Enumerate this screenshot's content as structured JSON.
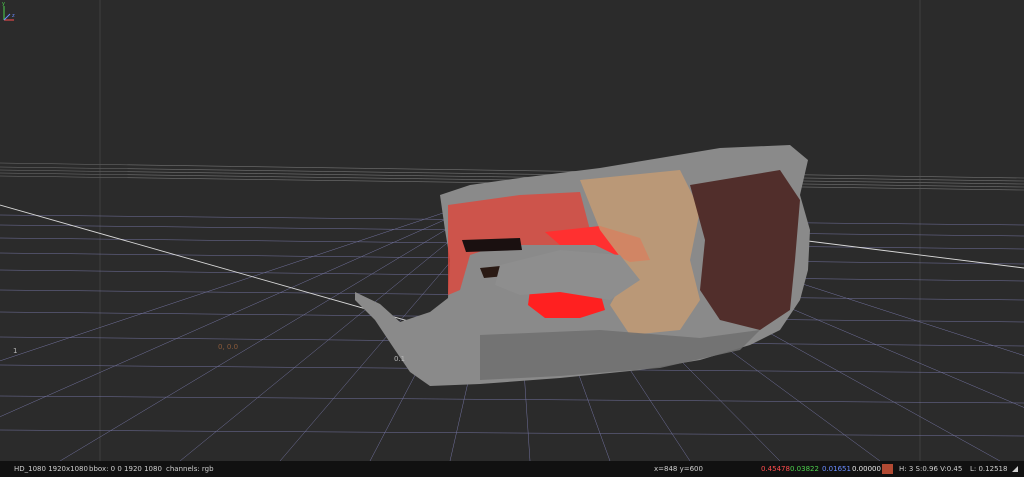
{
  "viewport": {
    "label_origin": "1",
    "label_near_object": "0.1",
    "label_left_marker": "0, 0.0"
  },
  "statusbar": {
    "format": "HD_1080 1920x1080",
    "bbox": "bbox: 0 0 1920 1080",
    "channels": "channels: rgb",
    "coords": "x=848 y=600",
    "r": "0.45478",
    "g": "0.03822",
    "b": "0.01651",
    "a": "0.00000",
    "swatch_color": "#b24a33",
    "hsv": "H:  3 S:0.96 V:0.45",
    "lum": "L: 0.12518"
  },
  "colors": {
    "r": "#ff4d4d",
    "g": "#4dd04d",
    "b": "#6a8cff",
    "a": "#e8e8e8"
  }
}
